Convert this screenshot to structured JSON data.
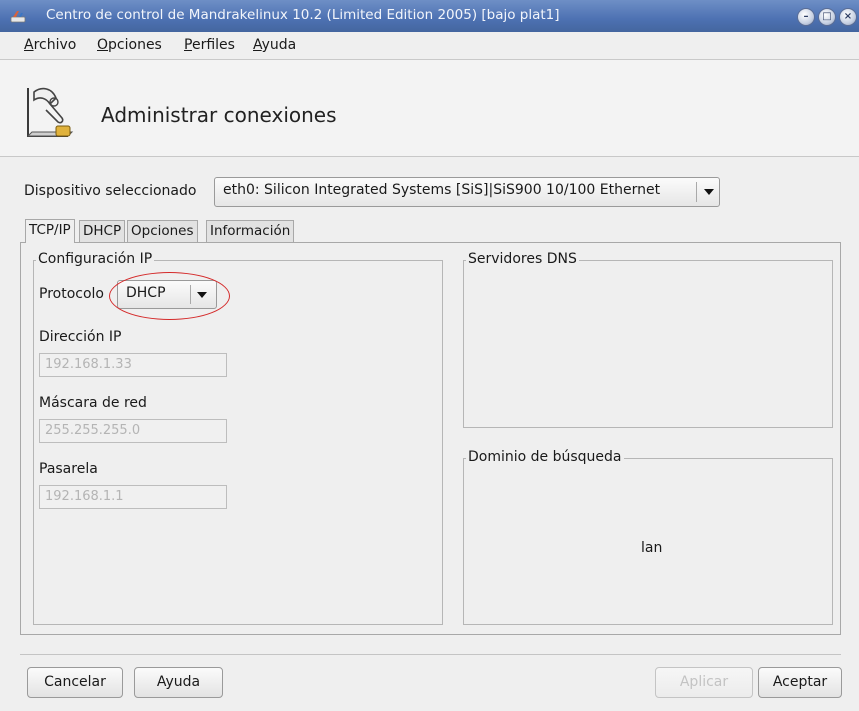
{
  "window": {
    "title": "Centro de control de Mandrakelinux 10.2 (Limited Edition 2005) [bajo plat1]",
    "buttons": [
      "minimize",
      "maximize",
      "close"
    ],
    "title_color": "#4d71b2"
  },
  "menubar": {
    "items": [
      {
        "accel": "A",
        "rest": "rchivo"
      },
      {
        "accel": "O",
        "rest": "pciones"
      },
      {
        "accel": "P",
        "rest": "erfiles"
      },
      {
        "accel": "A",
        "rest": "yuda"
      }
    ]
  },
  "header": {
    "title": "Administrar conexiones",
    "icon": "network-tools-icon"
  },
  "device": {
    "label": "Dispositivo seleccionado",
    "selected": "eth0: Silicon Integrated Systems [SiS]|SiS900 10/100 Ethernet"
  },
  "tabs": [
    {
      "label": "TCP/IP",
      "active": true
    },
    {
      "label": "DHCP",
      "active": false
    },
    {
      "label": "Opciones",
      "active": false
    },
    {
      "label": "Información",
      "active": false
    }
  ],
  "ip_config": {
    "frame_title": "Configuración IP",
    "protocol_label": "Protocolo",
    "protocol_value": "DHCP",
    "ip_label": "Dirección IP",
    "ip_value": "192.168.1.33",
    "netmask_label": "Máscara de red",
    "netmask_value": "255.255.255.0",
    "gateway_label": "Pasarela",
    "gateway_value": "192.168.1.1"
  },
  "dns": {
    "frame_title": "Servidores DNS"
  },
  "search_domain": {
    "frame_title": "Dominio de búsqueda",
    "value": "lan"
  },
  "buttons": {
    "cancel": "Cancelar",
    "help": "Ayuda",
    "apply": "Aplicar",
    "accept": "Aceptar"
  },
  "annotation": {
    "highlight_color": "#d42a2a"
  }
}
